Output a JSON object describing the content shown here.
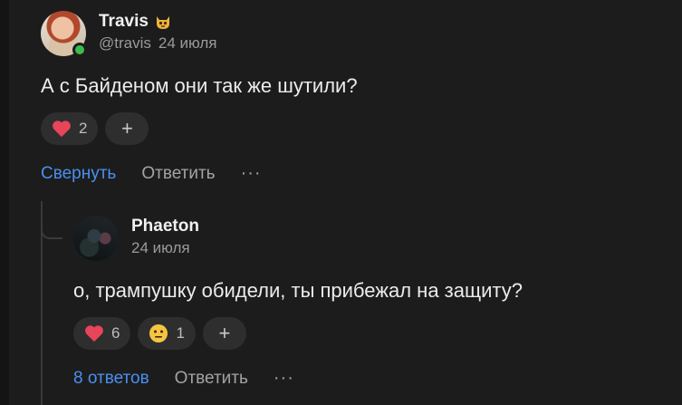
{
  "comments": [
    {
      "author": "Travis",
      "handle": "@travis",
      "date": "24 июля",
      "text": "А с Байденом они так же шутили?",
      "reactions": [
        {
          "emoji": "heart-icon",
          "count": "2"
        }
      ],
      "actions": {
        "collapse": "Свернуть",
        "reply": "Ответить",
        "more": "···"
      }
    },
    {
      "author": "Phaeton",
      "date": "24 июля",
      "text": "о, трампушку обидели, ты прибежал на защиту?",
      "reactions": [
        {
          "emoji": "heart-icon",
          "count": "6"
        },
        {
          "emoji": "neutral-face-icon",
          "count": "1"
        }
      ],
      "actions": {
        "replies": "8 ответов",
        "reply": "Ответить",
        "more": "···"
      }
    }
  ],
  "add_reaction_label": "+",
  "colors": {
    "background": "#1c1c1c",
    "link": "#4a8ff0",
    "heart": "#e8455a",
    "online": "#3bbd4b"
  }
}
